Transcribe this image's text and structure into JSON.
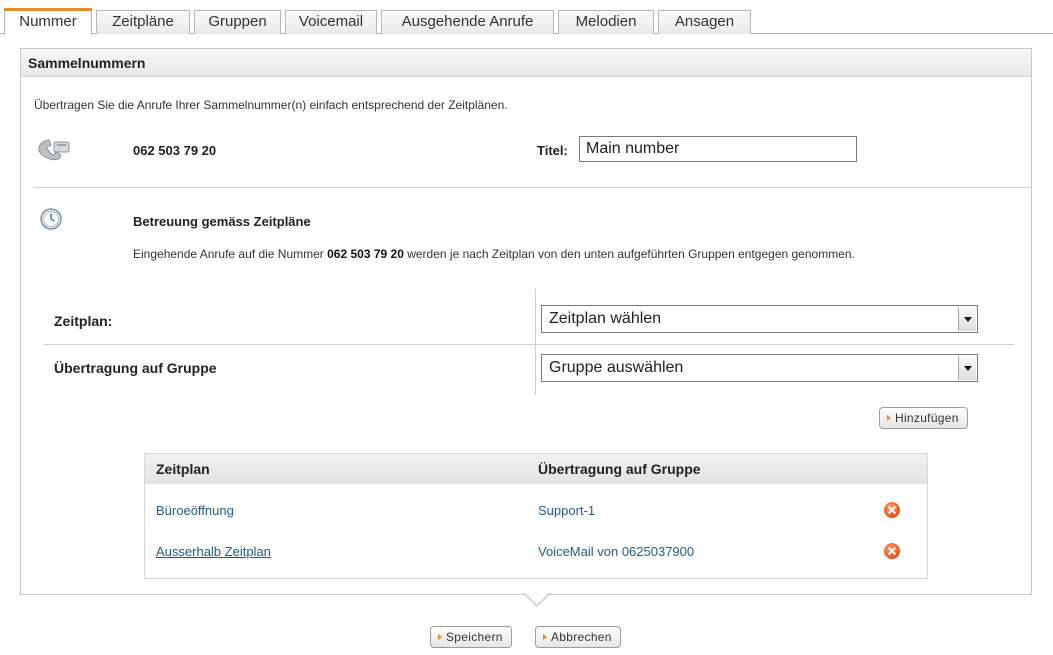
{
  "tabs": [
    {
      "label": "Nummer",
      "active": true
    },
    {
      "label": "Zeitpläne",
      "active": false
    },
    {
      "label": "Gruppen",
      "active": false
    },
    {
      "label": "Voicemail",
      "active": false
    },
    {
      "label": "Ausgehende Anrufe",
      "active": false
    },
    {
      "label": "Melodien",
      "active": false
    },
    {
      "label": "Ansagen",
      "active": false
    }
  ],
  "panel": {
    "title": "Sammelnummern",
    "intro": "Übertragen Sie die Anrufe Ihrer Sammelnummer(n) einfach entsprechend der Zeitplänen.",
    "number": "062 503 79 20",
    "title_label": "Titel:",
    "title_value": "Main number",
    "phone_icon": "phone-icon",
    "clock_icon": "clock-icon"
  },
  "schedule": {
    "heading": "Betreuung gemäss Zeitpläne",
    "desc_pre": "Eingehende Anrufe auf die Nummer ",
    "desc_number": "062 503 79 20",
    "desc_post": " werden je nach Zeitplan von den unten aufgeführten Gruppen entgegen genommen.",
    "zeitplan_label": "Zeitplan:",
    "zeitplan_select": "Zeitplan wählen",
    "gruppe_label": "Übertragung auf Gruppe",
    "gruppe_select": "Gruppe auswählen",
    "add_button": "Hinzufügen"
  },
  "table": {
    "headers": [
      "Zeitplan",
      "Übertragung auf Gruppe"
    ],
    "rows": [
      {
        "zeitplan": "Büroeöffnung",
        "gruppe": "Support-1"
      },
      {
        "zeitplan": "Ausserhalb Zeitplan",
        "gruppe": "VoiceMail von 0625037900"
      }
    ]
  },
  "footer": {
    "save": "Speichern",
    "cancel": "Abbrechen"
  },
  "colors": {
    "accent": "#e98a23",
    "link": "#2a5a8a",
    "delete": "#e5521e"
  }
}
